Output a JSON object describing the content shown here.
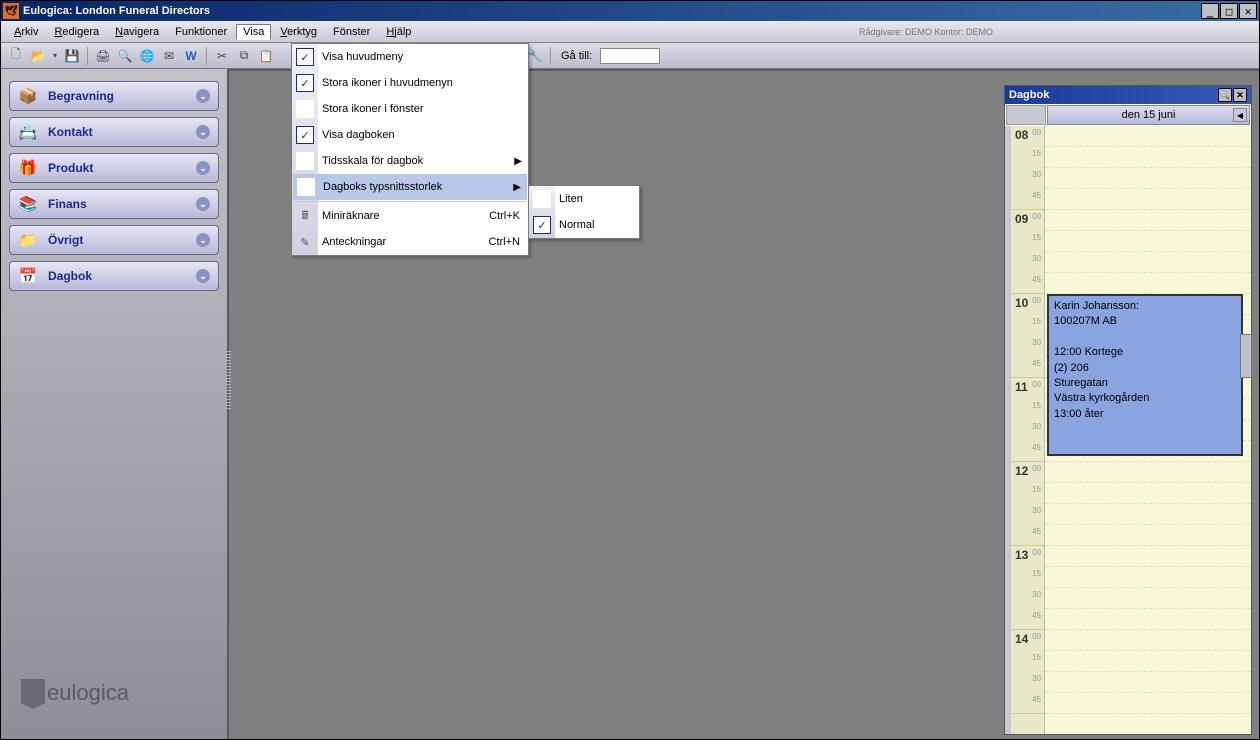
{
  "window": {
    "title": "Eulogica: London Funeral Directors"
  },
  "menubar": {
    "items": [
      "Arkiv",
      "Redigera",
      "Navigera",
      "Funktioner",
      "Visa",
      "Verktyg",
      "Fönster",
      "Hjälp"
    ],
    "underline_idx": [
      0,
      0,
      0,
      -1,
      -1,
      0,
      -1,
      0
    ],
    "active": "Visa",
    "info": "Rådgivare: DEMO   Kontor: DEMO"
  },
  "toolbar": {
    "goto_label": "Gå till:"
  },
  "sidebar": {
    "items": [
      {
        "label": "Begravning",
        "icon": "📦"
      },
      {
        "label": "Kontakt",
        "icon": "📇"
      },
      {
        "label": "Produkt",
        "icon": "🎁"
      },
      {
        "label": "Finans",
        "icon": "📚"
      },
      {
        "label": "Övrigt",
        "icon": "📁"
      },
      {
        "label": "Dagbok",
        "icon": "📅"
      }
    ],
    "brand": "eulogica"
  },
  "menu_visa": {
    "items": [
      {
        "label": "Visa huvudmeny",
        "checked": true
      },
      {
        "label": "Stora ikoner i huvudmenyn",
        "checked": true
      },
      {
        "label": "Stora ikoner i fönster",
        "checked": false
      },
      {
        "label": "Visa dagboken",
        "checked": true
      },
      {
        "label": "Tidsskala för dagbok",
        "submenu": true
      },
      {
        "label": "Dagboks typsnittsstorlek",
        "submenu": true,
        "highlight": true
      },
      {
        "label": "Miniräknare",
        "shortcut": "Ctrl+K",
        "icon": "calc"
      },
      {
        "label": "Anteckningar",
        "shortcut": "Ctrl+N",
        "icon": "note"
      }
    ]
  },
  "submenu_font": {
    "items": [
      {
        "label": "Liten",
        "checked": false
      },
      {
        "label": "Normal",
        "checked": true
      }
    ]
  },
  "dagbok": {
    "title": "Dagbok",
    "date": "den 15 juni",
    "hours": [
      "08",
      "09",
      "10",
      "11",
      "12",
      "13",
      "14"
    ],
    "minute_marks": [
      "00",
      "15",
      "30",
      "45"
    ],
    "event": {
      "top_hour_index": 2,
      "span_hours": 2,
      "lines": [
        "Karin Johansson:",
        "100207M AB",
        "",
        "12:00 Kortege",
        "(2) 206",
        "Sturegatan",
        "Västra kyrkogården",
        "13:00 åter"
      ]
    }
  }
}
